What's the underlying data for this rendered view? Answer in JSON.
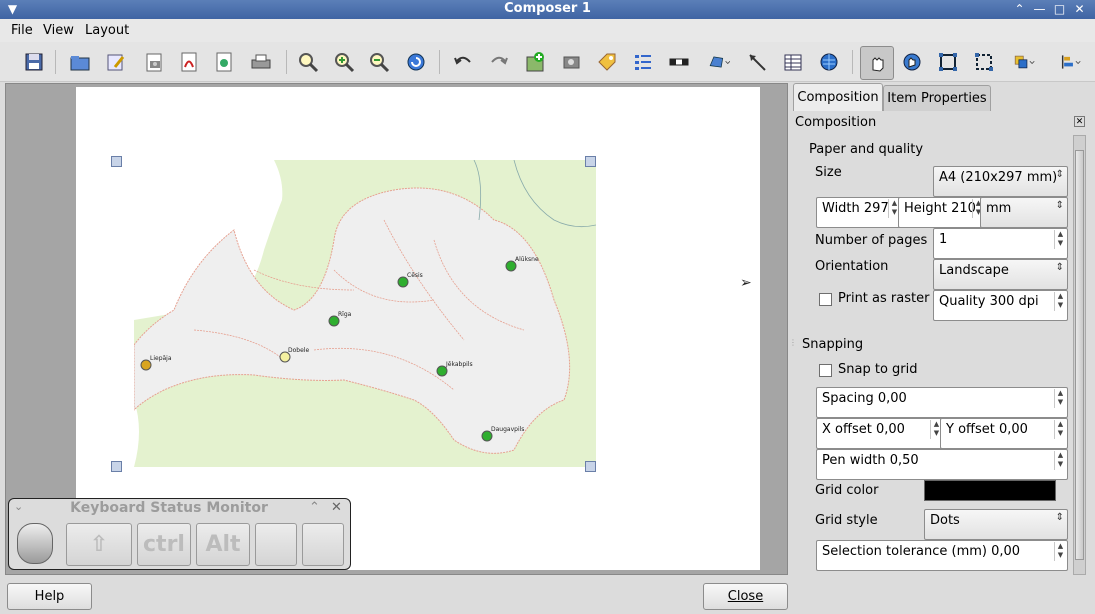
{
  "window": {
    "title": "Composer 1"
  },
  "menubar": {
    "items": [
      "File",
      "View",
      "Layout"
    ]
  },
  "toolbar": {
    "tools": [
      "save-icon",
      "open-template-icon",
      "save-template-icon",
      "export-image-icon",
      "export-pdf-icon",
      "export-svg-icon",
      "print-icon",
      "zoom-full-icon",
      "zoom-in-icon",
      "zoom-out-icon",
      "refresh-icon",
      "undo-icon",
      "redo-icon",
      "add-map-icon",
      "add-image-icon",
      "add-label-icon",
      "add-legend-icon",
      "add-scalebar-icon",
      "add-shape-icon",
      "add-arrow-icon",
      "add-table-icon",
      "add-html-icon",
      "select-move-icon",
      "move-content-icon",
      "group-icon",
      "ungroup-icon",
      "raise-items-icon",
      "align-icon"
    ]
  },
  "map": {
    "cities": [
      {
        "name": "Liepāja",
        "color": "#d9a520"
      },
      {
        "name": "Dobele",
        "color": "#f4f0a0"
      },
      {
        "name": "Rīga",
        "color": "#2fae2f"
      },
      {
        "name": "Cēsis",
        "color": "#2fae2f"
      },
      {
        "name": "Alūksne",
        "color": "#2fae2f"
      },
      {
        "name": "Jēkabpils",
        "color": "#2fae2f"
      },
      {
        "name": "Daugavpils",
        "color": "#2fae2f"
      }
    ]
  },
  "keyboard_monitor": {
    "title": "Keyboard Status Monitor",
    "keys": [
      "",
      "ctrl",
      "Alt",
      "",
      ""
    ]
  },
  "panel": {
    "tabs": [
      "Composition",
      "Item Properties"
    ],
    "active_tab": "Composition",
    "heading": "Composition",
    "paper_group": "Paper and quality",
    "size_label": "Size",
    "size_value": "A4 (210x297 mm)",
    "width_value": "Width 297",
    "height_value": "Height 210",
    "unit_value": "mm",
    "pages_label": "Number of pages",
    "pages_value": "1",
    "orientation_label": "Orientation",
    "orientation_value": "Landscape",
    "raster_label": "Print as raster",
    "quality_value": "Quality 300 dpi",
    "snapping_group": "Snapping",
    "snap_label": "Snap to grid",
    "spacing_value": "Spacing 0,00",
    "xoffset_value": "X offset 0,00",
    "yoffset_value": "Y offset 0,00",
    "penwidth_value": "Pen width 0,50",
    "gridcolor_label": "Grid color",
    "gridcolor": "#000000",
    "gridstyle_label": "Grid style",
    "gridstyle_value": "Dots",
    "tolerance_value": "Selection tolerance (mm) 0,00"
  },
  "footer": {
    "help": "Help",
    "close": "Close"
  }
}
